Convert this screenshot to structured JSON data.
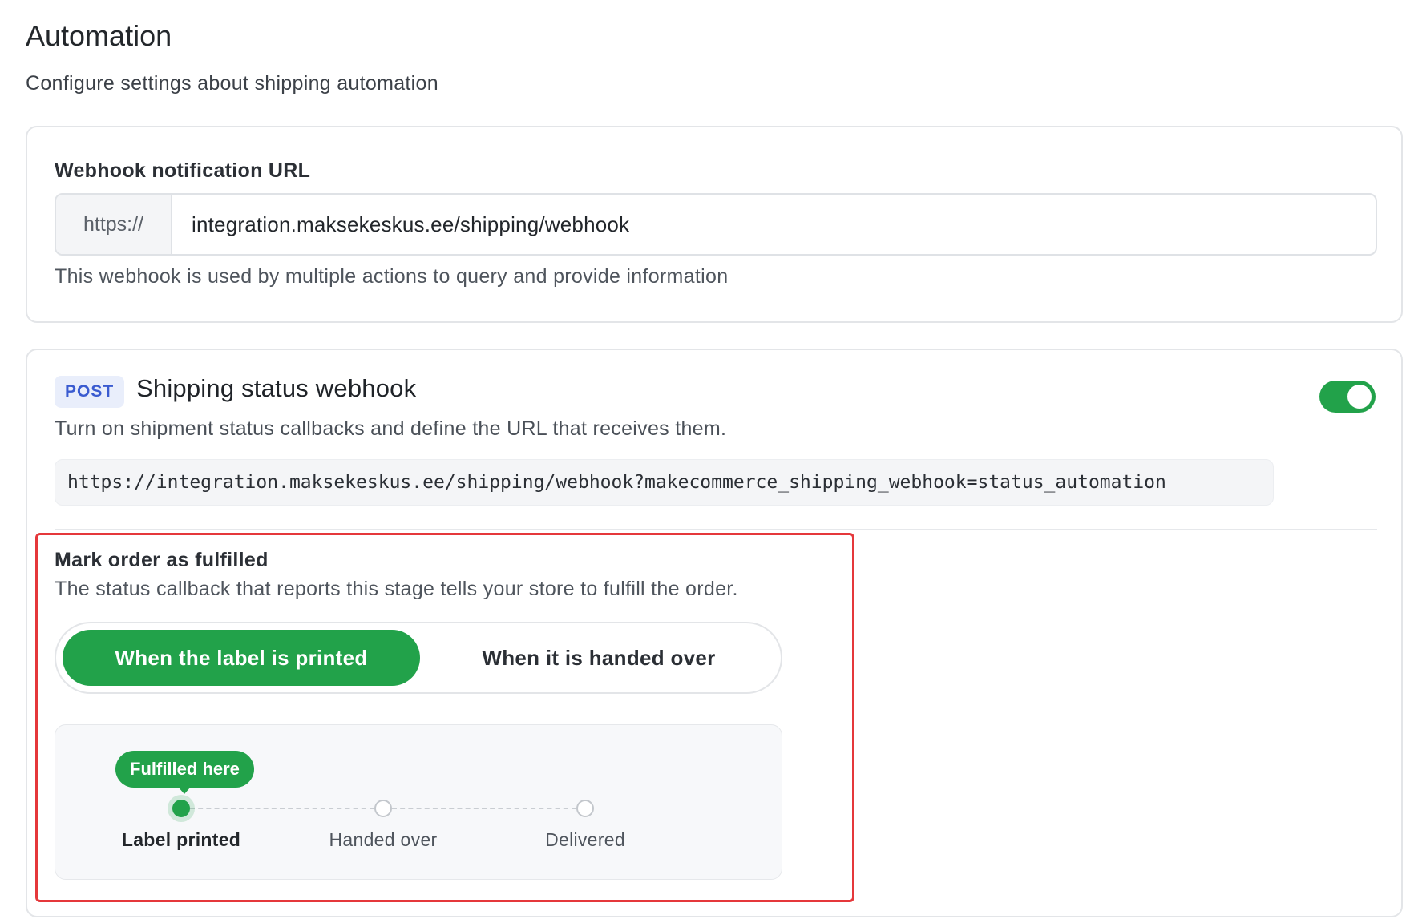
{
  "page": {
    "title": "Automation",
    "subtitle": "Configure settings about shipping automation"
  },
  "webhook": {
    "label": "Webhook notification URL",
    "prefix": "https://",
    "value": "integration.maksekeskus.ee/shipping/webhook",
    "help": "This webhook is used by multiple actions to query and provide information"
  },
  "status_webhook": {
    "method": "POST",
    "title": "Shipping status webhook",
    "enabled": true,
    "description": "Turn on shipment status callbacks and define the URL that receives them.",
    "url": "https://integration.maksekeskus.ee/shipping/webhook?makecommerce_shipping_webhook=status_automation"
  },
  "fulfill": {
    "title": "Mark order as fulfilled",
    "description": "The status callback that reports this stage tells your store to fulfill the order.",
    "options": [
      "When the label is printed",
      "When it is handed over"
    ],
    "selected": "When the label is printed",
    "tooltip": "Fulfilled here",
    "steps": [
      "Label printed",
      "Handed over",
      "Delivered"
    ],
    "active_step": "Label printed"
  },
  "colors": {
    "accent": "#22a24a",
    "highlight_border": "#e5383b",
    "post_badge_text": "#3a5bd0",
    "post_badge_bg": "#e9eefb"
  }
}
